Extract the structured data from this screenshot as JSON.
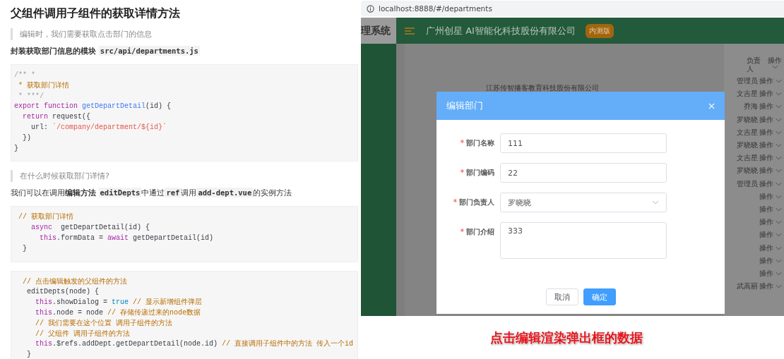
{
  "article": {
    "title": "父组件调用子组件的获取详情方法",
    "blocks": [
      {
        "kind": "quote",
        "text": "编辑时，我们需要获取点击部门的信息"
      },
      {
        "kind": "para",
        "bold": true,
        "segments": [
          {
            "kind": "text",
            "text": "封装获取部门信息的模块 "
          },
          {
            "kind": "code",
            "text": "src/api/departments.js"
          }
        ]
      },
      {
        "kind": "code",
        "lines": [
          [
            {
              "kind": "doc",
              "text": "/** *"
            }
          ],
          [
            {
              "kind": "cmt",
              "text": " * 获取部门详情"
            }
          ],
          [
            {
              "kind": "doc",
              "text": " * ***/"
            }
          ],
          [
            {
              "kind": "kw",
              "text": "export function "
            },
            {
              "kind": "fn",
              "text": "getDepartDetail"
            },
            {
              "kind": "plain",
              "text": "(id) {"
            }
          ],
          [
            {
              "kind": "kw",
              "text": "  return"
            },
            {
              "kind": "plain",
              "text": " request({"
            }
          ],
          [
            {
              "kind": "plain",
              "text": "    url: "
            },
            {
              "kind": "str",
              "text": "`/company/department/${id}`"
            }
          ],
          [
            {
              "kind": "plain",
              "text": "  })"
            }
          ],
          [
            {
              "kind": "plain",
              "text": "}"
            }
          ]
        ]
      },
      {
        "kind": "quote",
        "text": "在什么时候获取部门详情?"
      },
      {
        "kind": "para",
        "bold": false,
        "segments": [
          {
            "kind": "text",
            "text": "我们可以在调用**编辑方法** "
          },
          {
            "kind": "code",
            "text": "editDepts"
          },
          {
            "kind": "text",
            "text": "中通过"
          },
          {
            "kind": "code",
            "text": "ref"
          },
          {
            "kind": "text",
            "text": "调用"
          },
          {
            "kind": "code",
            "text": "add-dept.vue"
          },
          {
            "kind": "text",
            "text": "的实例方法"
          }
        ]
      },
      {
        "kind": "code",
        "lines": [
          [
            {
              "kind": "cmt",
              "text": " // 获取部门详情"
            }
          ],
          [
            {
              "kind": "kw",
              "text": "    async"
            },
            {
              "kind": "plain",
              "text": "  getDepartDetail(id) {"
            }
          ],
          [
            {
              "kind": "kw",
              "text": "      this"
            },
            {
              "kind": "plain",
              "text": ".formData = "
            },
            {
              "kind": "kw",
              "text": "await"
            },
            {
              "kind": "plain",
              "text": " getDepartDetail(id)"
            }
          ],
          [
            {
              "kind": "plain",
              "text": "  }"
            }
          ]
        ]
      },
      {
        "kind": "code",
        "lines": [
          [
            {
              "kind": "cmt",
              "text": "  // 点击编辑触发的父组件的方法"
            }
          ],
          [
            {
              "kind": "plain",
              "text": "   editDepts(node) {"
            }
          ],
          [
            {
              "kind": "kw",
              "text": "     this"
            },
            {
              "kind": "plain",
              "text": ".showDialog = "
            },
            {
              "kind": "lit",
              "text": "true"
            },
            {
              "kind": "cmt",
              "text": " // 显示新增组件弹层"
            }
          ],
          [
            {
              "kind": "kw",
              "text": "     this"
            },
            {
              "kind": "plain",
              "text": ".node = node "
            },
            {
              "kind": "cmt",
              "text": "// 存储传递过来的node数据"
            }
          ],
          [
            {
              "kind": "cmt",
              "text": "     // 我们需要在这个位置 调用子组件的方法"
            }
          ],
          [
            {
              "kind": "cmt",
              "text": "     // 父组件 调用子组件的方法"
            }
          ],
          [
            {
              "kind": "kw",
              "text": "     this"
            },
            {
              "kind": "plain",
              "text": ".$refs.addDept.getDepartDetail(node.id) "
            },
            {
              "kind": "cmt",
              "text": "// 直接调用子组件中的方法 传入一个id"
            }
          ],
          [
            {
              "kind": "plain",
              "text": "   }"
            }
          ]
        ]
      }
    ]
  },
  "app": {
    "address": "localhost:8888/#/departments",
    "logo_text": "理系统",
    "company": "广州创星 AI智能化科技股份有限公司",
    "badge": "内测版",
    "background_company": "江苏传智播客教育科技股份有限公司",
    "list_headers": [
      "负责人",
      "操作"
    ],
    "rows": [
      {
        "person": "管理员",
        "action": "操作"
      },
      {
        "person": "文吉星",
        "action": "操作"
      },
      {
        "person": "乔海",
        "action": "操作"
      },
      {
        "person": "罗晓晓",
        "action": "操作"
      },
      {
        "person": "文吉星",
        "action": "操作"
      },
      {
        "person": "罗晓晓",
        "action": "操作"
      },
      {
        "person": "文吉星",
        "action": "操作"
      },
      {
        "person": "罗晓晓",
        "action": "操作"
      },
      {
        "person": "管理员",
        "action": "操作"
      },
      {
        "action": "操作"
      },
      {
        "action": "操作"
      },
      {
        "action": "操作"
      },
      {
        "action": "操作"
      },
      {
        "action": "操作"
      },
      {
        "action": "操作"
      },
      {
        "action": "操作"
      },
      {
        "person": "武高丽",
        "action": "操作"
      }
    ],
    "dialog": {
      "title": "编辑部门",
      "fields": [
        {
          "kind": "input",
          "required_mark": "*",
          "label": "部门名称",
          "value": "111"
        },
        {
          "kind": "input",
          "required_mark": "*",
          "label": "部门编码",
          "value": "22"
        },
        {
          "kind": "select",
          "required_mark": "*",
          "label": "部门负责人",
          "value": "罗晓晓"
        },
        {
          "kind": "textarea",
          "required_mark": "*",
          "label": "部门介绍",
          "value": "333"
        }
      ],
      "buttons": [
        {
          "kind": "default",
          "label": "取消"
        },
        {
          "kind": "primary",
          "label": "确定"
        }
      ]
    }
  },
  "caption": "点击编辑渲染弹出框的数据"
}
